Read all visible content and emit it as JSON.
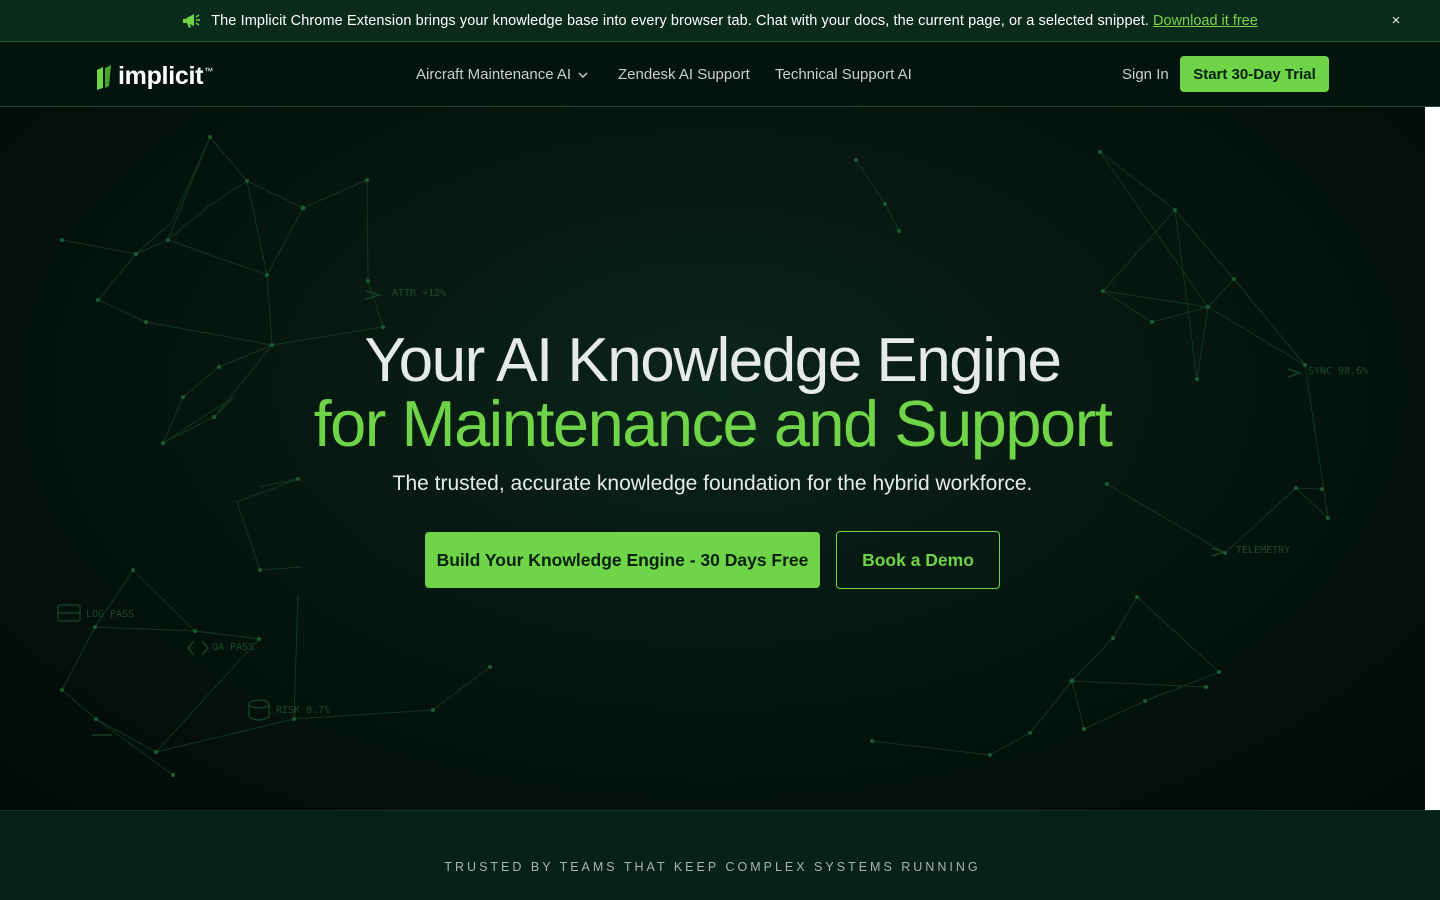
{
  "banner": {
    "icon": "megaphone-icon",
    "text": "The Implicit Chrome Extension brings your knowledge base into every browser tab. Chat with your docs, the current page, or a selected snippet.",
    "link_label": "Download it free",
    "close_label": "×"
  },
  "nav": {
    "logo_text": "implicit",
    "logo_tm": "™",
    "links": [
      {
        "label": "Aircraft Maintenance AI",
        "has_dropdown": true
      },
      {
        "label": "Zendesk AI Support"
      },
      {
        "label": "Technical Support AI"
      }
    ],
    "signin_label": "Sign In",
    "trial_label": "Start 30-Day Trial"
  },
  "hero": {
    "headline_line1": "Your AI Knowledge Engine",
    "headline_line2": "for Maintenance and Support",
    "subhead": "The trusted, accurate knowledge foundation for the hybrid workforce.",
    "primary_cta": "Build Your Knowledge Engine - 30 Days Free",
    "secondary_cta": "Book a Demo",
    "network_labels": [
      "ATTR +12%",
      "SYNC 98.6%",
      "TELEMETRY",
      "LOG PASS",
      "QA PASS",
      "RISK 0.7%"
    ]
  },
  "trusted": {
    "label": "TRUSTED BY TEAMS THAT KEEP COMPLEX SYSTEMS RUNNING"
  },
  "colors": {
    "accent": "#6fd448",
    "banner_bg": "#0a2a1c",
    "nav_bg": "#03140e",
    "hero_bg": "#061710"
  }
}
